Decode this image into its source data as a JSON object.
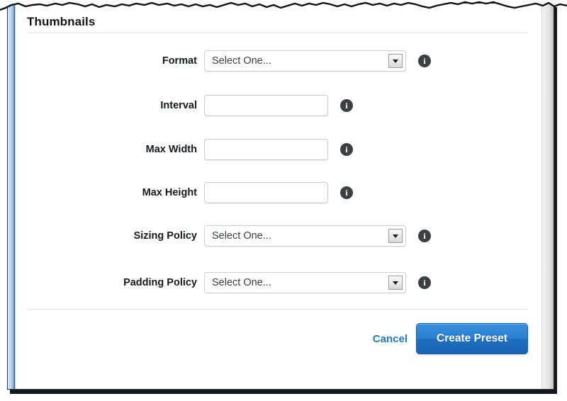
{
  "section": {
    "title": "Thumbnails"
  },
  "form": {
    "rows": [
      {
        "label": "Format",
        "control": "select",
        "value": "Select One...",
        "info_icon": "info-icon"
      },
      {
        "label": "Interval",
        "control": "input",
        "value": "",
        "placeholder": "",
        "info_icon": "info-icon"
      },
      {
        "label": "Max Width",
        "control": "input",
        "value": "",
        "placeholder": "",
        "info_icon": "info-icon"
      },
      {
        "label": "Max Height",
        "control": "input",
        "value": "",
        "placeholder": "",
        "info_icon": "info-icon"
      },
      {
        "label": "Sizing Policy",
        "control": "select",
        "value": "Select One...",
        "info_icon": "info-icon"
      },
      {
        "label": "Padding Policy",
        "control": "select",
        "value": "Select One...",
        "info_icon": "info-icon"
      }
    ]
  },
  "footer": {
    "cancel_label": "Cancel",
    "submit_label": "Create Preset"
  },
  "icons": {
    "info": "i",
    "dropdown_arrow": "chevron-down-icon"
  },
  "colors": {
    "primary_button": "#2a7fd0",
    "link": "#1f78d1",
    "label_text": "#16191c",
    "field_border": "#cfcfcf",
    "divider": "#e2e4e6",
    "info_icon_bg": "#3d3f41",
    "left_edge": "#9dc0e4",
    "scrollbar": "#e3e3e3"
  }
}
